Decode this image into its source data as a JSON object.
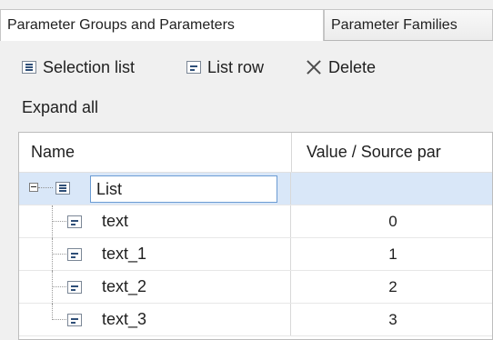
{
  "tabs": [
    {
      "label": "Parameter Groups and Parameters",
      "active": true
    },
    {
      "label": "Parameter Families",
      "active": false
    }
  ],
  "toolbar": {
    "selection_list": {
      "label": "Selection list",
      "icon": "selection-list-icon"
    },
    "list_row": {
      "label": "List row",
      "icon": "list-row-icon"
    },
    "delete": {
      "label": "Delete",
      "icon": "delete-icon"
    }
  },
  "expand_all": "Expand all",
  "grid": {
    "columns": [
      "Name",
      "Value / Source par"
    ],
    "list": {
      "name": "List",
      "value": "",
      "expanded": true
    },
    "rows": [
      {
        "name": "text",
        "value": "0"
      },
      {
        "name": "text_1",
        "value": "1"
      },
      {
        "name": "text_2",
        "value": "2"
      },
      {
        "name": "text_3",
        "value": "3"
      }
    ]
  },
  "colors": {
    "selected_row": "#d9e7f8",
    "focus_border": "#6b9bd3",
    "grid_line": "#d8d8d8"
  }
}
